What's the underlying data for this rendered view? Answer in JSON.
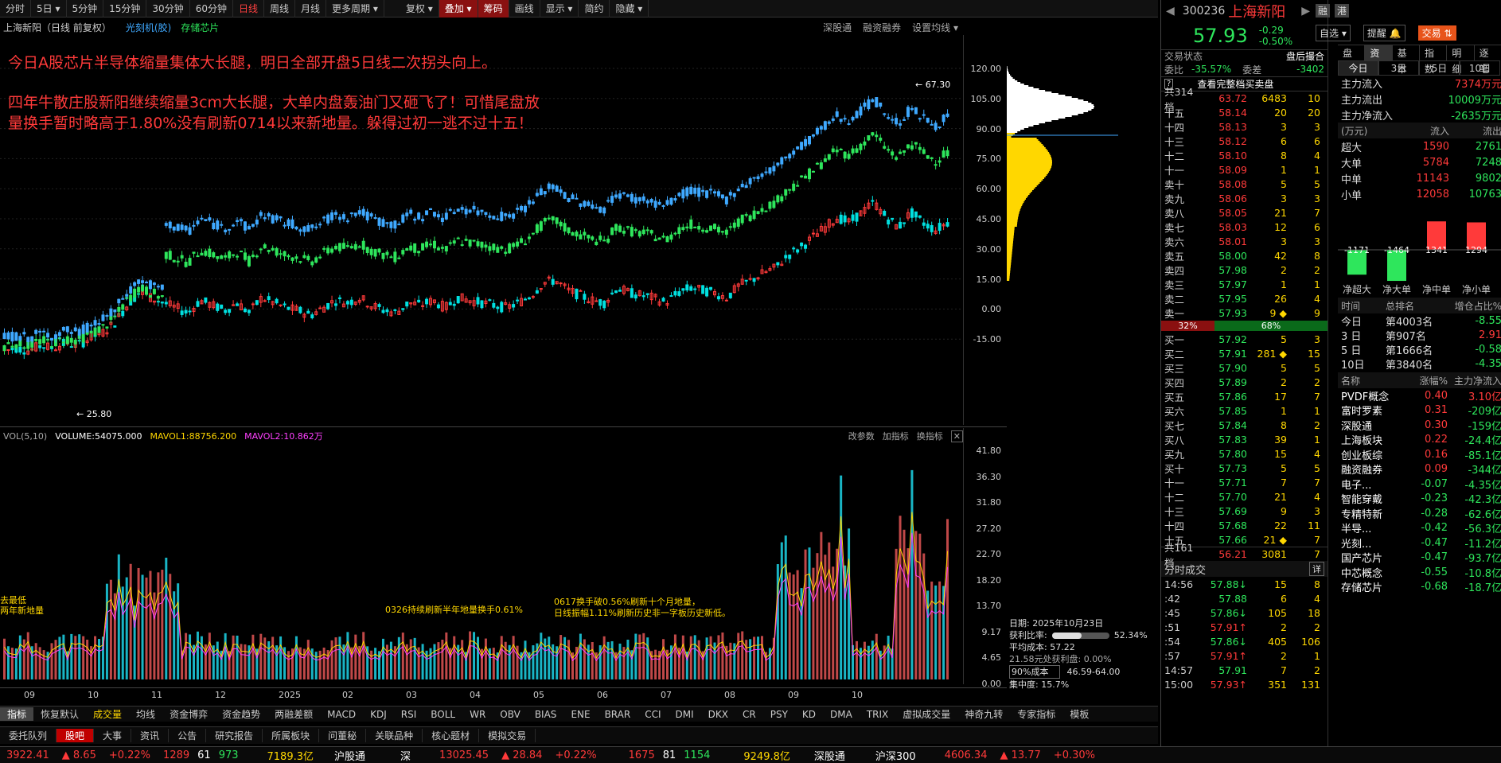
{
  "toolbar": {
    "periods": [
      "分时",
      "5日 ▾",
      "5分钟",
      "15分钟",
      "30分钟",
      "60分钟",
      "日线",
      "周线",
      "月线",
      "更多周期 ▾"
    ],
    "active_period": "日线",
    "tools": [
      "复权 ▾",
      "叠加 ▾",
      "筹码",
      "画线",
      "显示 ▾",
      "简约",
      "隐藏 ▾"
    ]
  },
  "chart": {
    "title": "上海新阳（日线 前复权）",
    "tags": [
      "光刻机(胶)",
      "存储芯片"
    ],
    "right_links": [
      "深股通",
      "融资融券",
      "设置均线 ▾"
    ],
    "annotation1": "今日A股芯片半导体缩量集体大长腿，明日全部开盘5日线二次拐头向上。",
    "annotation2": "四年牛散庄股新阳继续缩量3cm大长腿，大单内盘轰油门又砸飞了！可惜尾盘放",
    "annotation3": "量换手暂时略高于1.80%没有刷新0714以来新地量。躲得过初一逃不过十五！",
    "y_ticks": [
      "120.00",
      "105.00",
      "90.00",
      "75.00",
      "60.00",
      "45.00",
      "30.00",
      "15.00",
      "0.00",
      "-15.00"
    ],
    "high_label": "67.30",
    "low_label": "25.80"
  },
  "chart_data": {
    "type": "candlestick",
    "y_axis": [
      -15,
      120
    ],
    "series": [
      {
        "name": "price",
        "values": [
          7,
          8,
          7,
          9,
          8,
          10,
          9,
          12,
          14,
          18,
          25,
          30,
          28,
          26,
          24,
          22,
          27,
          25,
          23,
          26,
          22,
          28,
          26,
          24,
          23,
          21,
          24,
          27,
          26,
          28,
          25,
          23,
          22,
          26,
          25,
          27,
          24,
          28,
          27,
          26,
          25,
          24,
          26,
          29,
          34,
          35,
          31,
          29,
          27,
          26,
          32,
          30,
          29,
          28,
          26,
          30,
          32,
          31,
          30,
          28,
          33,
          35,
          38,
          40,
          45,
          48,
          52,
          56,
          60,
          58,
          62,
          66,
          60,
          56,
          62,
          58,
          55,
          58
        ]
      },
      {
        "name": "MAVOL1",
        "values": [
          88756.2
        ]
      },
      {
        "name": "MAVOL2",
        "values": [
          10.862
        ]
      }
    ],
    "vol_labels": [
      "VOL(5,10)",
      "VOLUME:54075.000",
      "MAVOL1:88756.200",
      "MAVOL2:10.862万"
    ],
    "vol_y_ticks": [
      "41.80",
      "36.30",
      "31.80",
      "27.20",
      "22.70",
      "18.20",
      "13.70",
      "9.17",
      "4.65",
      "0.00"
    ],
    "x_ticks": [
      "09",
      "10",
      "11",
      "12",
      "2025",
      "02",
      "03",
      "04",
      "05",
      "06",
      "07",
      "08",
      "09",
      "10"
    ]
  },
  "vol_panel": {
    "title": "VOL(5,10)",
    "buttons": [
      "改参数",
      "加指标",
      "换指标"
    ],
    "note_left": "去最低\n两年新地量",
    "note_mid": "0326持续刷新半年地量换手0.61%",
    "note_right1": "0617换手破0.56%刷新十个月地量，",
    "note_right2": "日线振幅1.11%刷新历史非一字板历史新低。"
  },
  "cost_panel": {
    "date": "日期: 2025年10月23日",
    "profit_ratio_label": "获利比率:",
    "profit_ratio": "52.34%",
    "avg_cost": "平均成本: 57.22",
    "profit_line": "21.58元处获利盘: 0.00%",
    "cost_select": "90%成本",
    "range": "46.59-64.00",
    "concentration": "集中度: 15.7%"
  },
  "indicator_tabs": [
    "指标",
    "恢复默认",
    "成交量",
    "均线",
    "资金博弈",
    "资金趋势",
    "两融差额",
    "MACD",
    "KDJ",
    "RSI",
    "BOLL",
    "WR",
    "OBV",
    "BIAS",
    "ENE",
    "BRAR",
    "CCI",
    "DMI",
    "DKX",
    "CR",
    "PSY",
    "KD",
    "DMA",
    "TRIX",
    "虚拟成交量",
    "神奇九转",
    "专家指标",
    "模板"
  ],
  "bottom_tabs": [
    "委托队列",
    "股吧",
    "大事",
    "资讯",
    "公告",
    "研究报告",
    "所属板块",
    "问董秘",
    "关联品种",
    "核心题材",
    "模拟交易"
  ],
  "status_bar": {
    "sh_index": "3922.41",
    "sh_change": "▲ 8.65",
    "sh_pct": "+0.22%",
    "sh_up": "1289",
    "sh_flat": "61",
    "sh_down": "973",
    "sh_amount": "7189.3亿",
    "hgt": "沪股通",
    "sz_label": "深",
    "sz_index": "13025.45",
    "sz_change": "▲ 28.84",
    "sz_pct": "+0.22%",
    "sz_up": "1675",
    "sz_flat": "81",
    "sz_down": "1154",
    "sz_amount": "9249.8亿",
    "sgt": "深股通",
    "hs300": "沪深300",
    "hs300_val": "4606.34",
    "hs300_change": "▲ 13.77",
    "hs300_pct": "+0.30%"
  },
  "quote": {
    "code": "300236",
    "name": "上海新阳",
    "badges": [
      "融",
      "港"
    ],
    "price": "57.93",
    "change": "-0.29",
    "change_pct": "-0.50%",
    "watch_btn": "自选 ▾",
    "remind_btn": "提醒",
    "trade_btn": "交易",
    "trade_status_label": "交易状态",
    "trade_status": "盘后撮合",
    "weibi_label": "委比",
    "weibi": "-35.57%",
    "weicha_label": "委差",
    "weicha": "-3402",
    "full_book": "查看完整档买卖盘",
    "ask_total_label": "共314档",
    "ask_total_price": "63.72",
    "ask_total_vol": "6483",
    "ask_total_cnt": "10",
    "asks": [
      [
        "十五",
        "58.14",
        "20",
        "20"
      ],
      [
        "十四",
        "58.13",
        "3",
        "3"
      ],
      [
        "十三",
        "58.12",
        "6",
        "6"
      ],
      [
        "十二",
        "58.10",
        "8",
        "4"
      ],
      [
        "十一",
        "58.09",
        "1",
        "1"
      ],
      [
        "卖十",
        "58.08",
        "5",
        "5"
      ],
      [
        "卖九",
        "58.06",
        "3",
        "3"
      ],
      [
        "卖八",
        "58.05",
        "21",
        "7"
      ],
      [
        "卖七",
        "58.03",
        "12",
        "6"
      ],
      [
        "卖六",
        "58.01",
        "3",
        "3"
      ],
      [
        "卖五",
        "58.00",
        "42",
        "8"
      ],
      [
        "卖四",
        "57.98",
        "2",
        "2"
      ],
      [
        "卖三",
        "57.97",
        "1",
        "1"
      ],
      [
        "卖二",
        "57.95",
        "26",
        "4"
      ],
      [
        "卖一",
        "57.93",
        "9 ◆",
        "9"
      ]
    ],
    "ratio_left": "32%",
    "ratio_right": "68%",
    "bids": [
      [
        "买一",
        "57.92",
        "5",
        "3"
      ],
      [
        "买二",
        "57.91",
        "281 ◆",
        "15"
      ],
      [
        "买三",
        "57.90",
        "5",
        "5"
      ],
      [
        "买四",
        "57.89",
        "2",
        "2"
      ],
      [
        "买五",
        "57.86",
        "17",
        "7"
      ],
      [
        "买六",
        "57.85",
        "1",
        "1"
      ],
      [
        "买七",
        "57.84",
        "8",
        "2"
      ],
      [
        "买八",
        "57.83",
        "39",
        "1"
      ],
      [
        "买九",
        "57.80",
        "15",
        "4"
      ],
      [
        "买十",
        "57.73",
        "5",
        "5"
      ],
      [
        "十一",
        "57.71",
        "7",
        "7"
      ],
      [
        "十二",
        "57.70",
        "21",
        "4"
      ],
      [
        "十三",
        "57.69",
        "9",
        "3"
      ],
      [
        "十四",
        "57.68",
        "22",
        "11"
      ],
      [
        "十五",
        "57.66",
        "21 ◆",
        "7"
      ]
    ],
    "bid_total_label": "共161档",
    "bid_total_price": "56.21",
    "bid_total_vol": "3081",
    "bid_total_cnt": "7",
    "ticks_title": "分时成交",
    "ticks_detail": "详",
    "ticks": [
      [
        "14:56",
        "57.88↓",
        "15",
        "8"
      ],
      [
        ":42",
        "57.88",
        "6",
        "4"
      ],
      [
        ":45",
        "57.86↓",
        "105",
        "18"
      ],
      [
        ":51",
        "57.91↑",
        "2",
        "2"
      ],
      [
        ":54",
        "57.86↓",
        "405",
        "106"
      ],
      [
        ":57",
        "57.91↑",
        "2",
        "1"
      ],
      [
        "14:57",
        "57.91",
        "7",
        "2"
      ],
      [
        "15:00",
        "57.93↑",
        "351",
        "131"
      ]
    ]
  },
  "fund": {
    "tabs": [
      "盘口",
      "资金",
      "基本",
      "指数",
      "明细",
      "逐笔"
    ],
    "active_tab": "资金",
    "period_tabs": [
      "今日",
      "3日",
      "5日",
      "10日"
    ],
    "main_in_label": "主力流入",
    "main_in": "7374万元",
    "main_out_label": "主力流出",
    "main_out": "10009万元",
    "main_net_label": "主力净流入",
    "main_net": "-2635万元",
    "table_head": [
      "(万元)",
      "流入",
      "流出"
    ],
    "rows": [
      [
        "超大",
        "1590",
        "2761"
      ],
      [
        "大单",
        "5784",
        "7248"
      ],
      [
        "中单",
        "11143",
        "9802"
      ],
      [
        "小单",
        "12058",
        "10763"
      ]
    ],
    "bars": [
      {
        "label": "净超大",
        "value": -1171
      },
      {
        "label": "净大单",
        "value": -1464
      },
      {
        "label": "净中单",
        "value": 1341
      },
      {
        "label": "净小单",
        "value": 1294
      }
    ],
    "bar_value_labels": [
      "-1171",
      "-1464",
      "1341",
      "1294"
    ],
    "rank_head": [
      "时间",
      "总排名",
      "增仓占比%"
    ],
    "ranks": [
      [
        "今日",
        "第4003名",
        "-8.55"
      ],
      [
        "3 日",
        "第907名",
        "2.91"
      ],
      [
        "5 日",
        "第1666名",
        "-0.58"
      ],
      [
        "10日",
        "第3840名",
        "-4.35"
      ]
    ],
    "sector_head": [
      "名称",
      "涨幅%",
      "主力净流入"
    ],
    "sectors": [
      [
        "PVDF概念",
        "0.40",
        "3.10亿"
      ],
      [
        "富时罗素",
        "0.31",
        "-209亿"
      ],
      [
        "深股通",
        "0.30",
        "-159亿"
      ],
      [
        "上海板块",
        "0.22",
        "-24.4亿"
      ],
      [
        "创业板综",
        "0.16",
        "-85.1亿"
      ],
      [
        "融资融券",
        "0.09",
        "-344亿"
      ],
      [
        "电子...",
        "-0.07",
        "-4.35亿"
      ],
      [
        "智能穿戴",
        "-0.23",
        "-42.3亿"
      ],
      [
        "专精特新",
        "-0.28",
        "-62.6亿"
      ],
      [
        "半导...",
        "-0.42",
        "-56.3亿"
      ],
      [
        "光刻...",
        "-0.47",
        "-11.2亿"
      ],
      [
        "国产芯片",
        "-0.47",
        "-93.7亿"
      ],
      [
        "中芯概念",
        "-0.55",
        "-10.8亿"
      ],
      [
        "存储芯片",
        "-0.68",
        "-18.7亿"
      ]
    ]
  }
}
